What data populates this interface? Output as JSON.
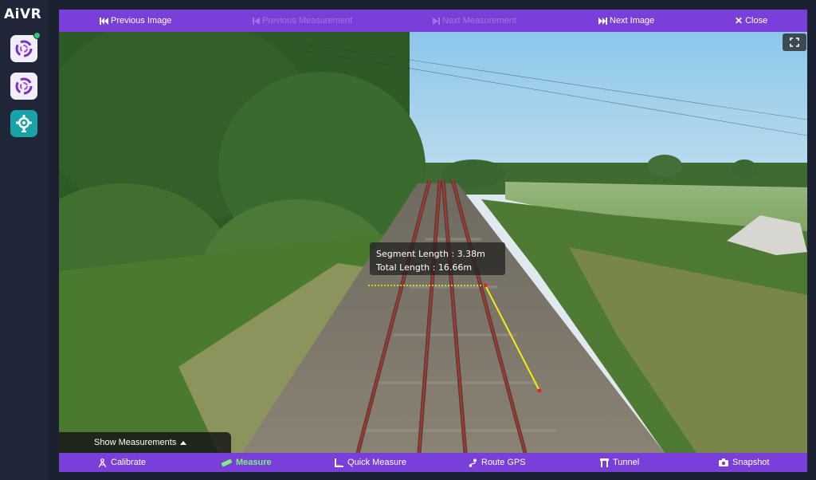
{
  "app": {
    "logo": "AiVR"
  },
  "topbar": {
    "previous_image": "Previous Image",
    "previous_measurement": "Previous Measurement",
    "next_measurement": "Next Measurement",
    "next_image": "Next Image",
    "close": "Close"
  },
  "measurement": {
    "segment_length": "Segment Length : 3.38m",
    "total_length": "Total Length : 16.66m"
  },
  "overlay": {
    "show_measurements": "Show Measurements"
  },
  "toolbar": {
    "calibrate": "Calibrate",
    "measure": "Measure",
    "quick_measure": "Quick Measure",
    "route_gps": "Route GPS",
    "tunnel": "Tunnel",
    "snapshot": "Snapshot"
  },
  "colors": {
    "accent": "#7b3fd9",
    "active_tool": "#7df07a",
    "rail_line": "#e0241e",
    "measure_line": "#f2ee10",
    "status_online": "#2ecc71"
  }
}
